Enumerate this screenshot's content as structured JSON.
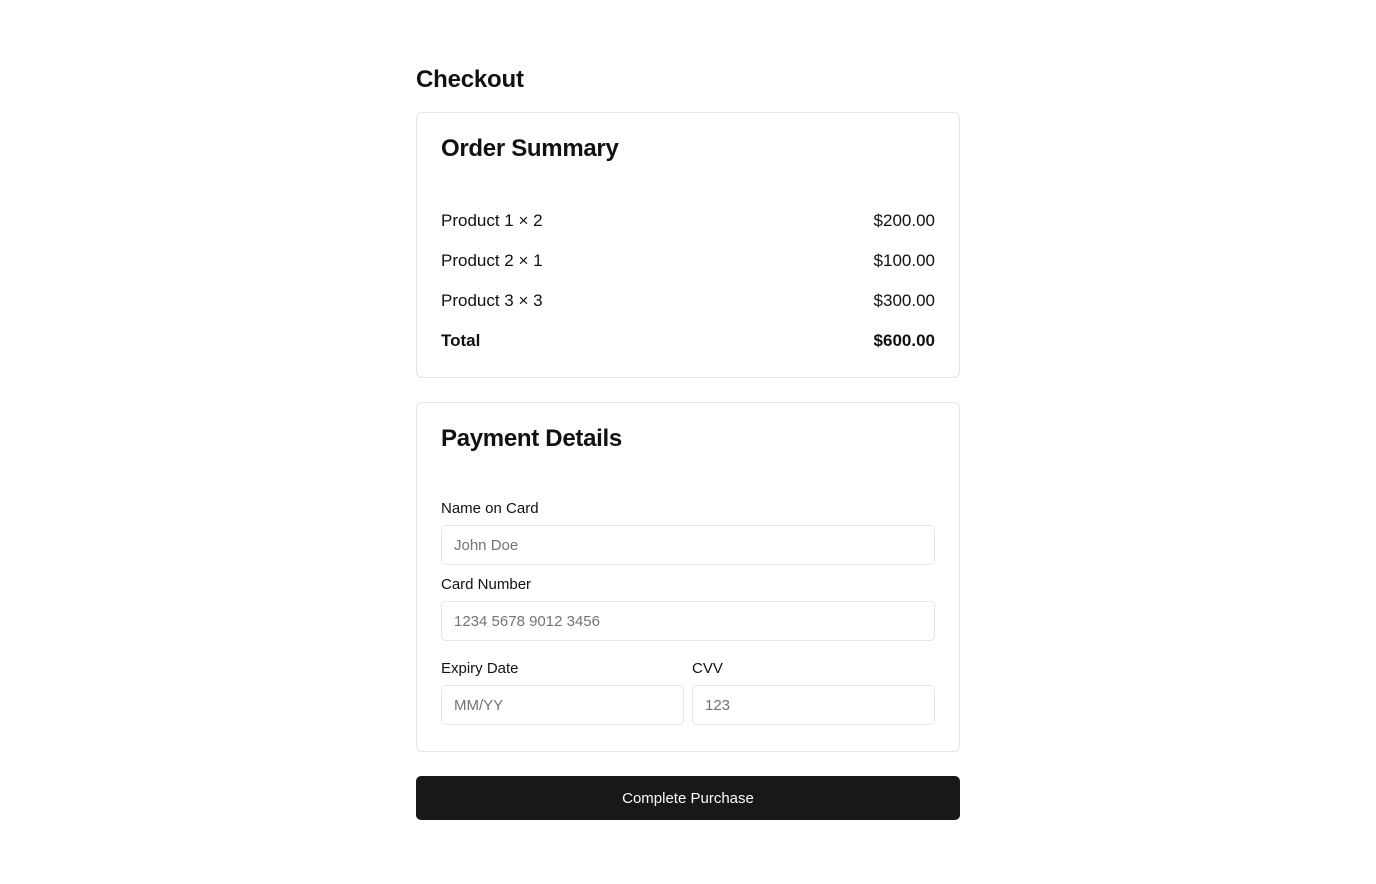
{
  "page": {
    "title": "Checkout"
  },
  "order_summary": {
    "title": "Order Summary",
    "items": [
      {
        "name": "Product 1 × 2",
        "amount": "$200.00"
      },
      {
        "name": "Product 2 × 1",
        "amount": "$100.00"
      },
      {
        "name": "Product 3 × 3",
        "amount": "$300.00"
      }
    ],
    "total_label": "Total",
    "total_amount": "$600.00"
  },
  "payment": {
    "title": "Payment Details",
    "name_on_card": {
      "label": "Name on Card",
      "placeholder": "John Doe",
      "value": ""
    },
    "card_number": {
      "label": "Card Number",
      "placeholder": "1234 5678 9012 3456",
      "value": ""
    },
    "expiry": {
      "label": "Expiry Date",
      "placeholder": "MM/YY",
      "value": ""
    },
    "cvv": {
      "label": "CVV",
      "placeholder": "123",
      "value": ""
    }
  },
  "actions": {
    "submit_label": "Complete Purchase"
  },
  "colors": {
    "button_bg": "#18181b",
    "border": "#e4e4e7",
    "placeholder": "#737373"
  }
}
